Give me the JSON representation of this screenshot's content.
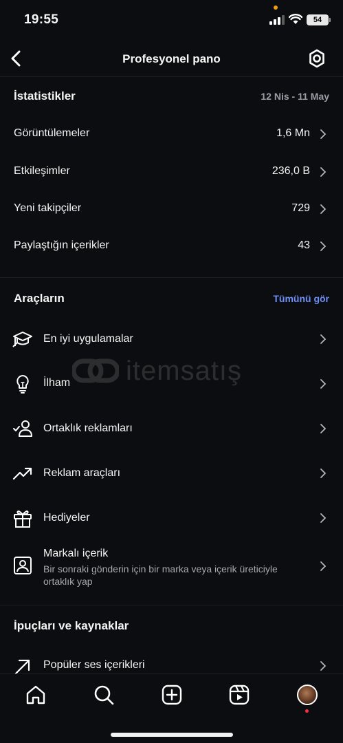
{
  "status_bar": {
    "time": "19:55",
    "battery": "54"
  },
  "header": {
    "title": "Profesyonel pano"
  },
  "statistics": {
    "title": "İstatistikler",
    "date_range": "12 Nis - 11 May",
    "rows": [
      {
        "label": "Görüntülemeler",
        "value": "1,6 Mn"
      },
      {
        "label": "Etkileşimler",
        "value": "236,0 B"
      },
      {
        "label": "Yeni takipçiler",
        "value": "729"
      },
      {
        "label": "Paylaştığın içerikler",
        "value": "43"
      }
    ]
  },
  "tools": {
    "title": "Araçların",
    "see_all": "Tümünü gör",
    "items": [
      {
        "label": "En iyi uygulamalar",
        "icon": "graduation-cap-icon"
      },
      {
        "label": "İlham",
        "icon": "lightbulb-icon"
      },
      {
        "label": "Ortaklık reklamları",
        "icon": "person-check-icon"
      },
      {
        "label": "Reklam araçları",
        "icon": "trending-up-icon"
      },
      {
        "label": "Hediyeler",
        "icon": "gift-icon"
      },
      {
        "label": "Markalı içerik",
        "sublabel": "Bir sonraki gönderin için bir marka veya içerik üreticiyle ortaklık yap",
        "icon": "branded-content-icon"
      }
    ]
  },
  "tips": {
    "title": "İpuçları ve kaynaklar",
    "items": [
      {
        "label": "Popüler ses içerikleri",
        "icon": "arrow-up-right-icon"
      }
    ]
  },
  "watermark": {
    "text": "itemsatış"
  },
  "colors": {
    "background": "#0c0d10",
    "link": "#6d8ff7",
    "muted": "#9b9ea5"
  }
}
